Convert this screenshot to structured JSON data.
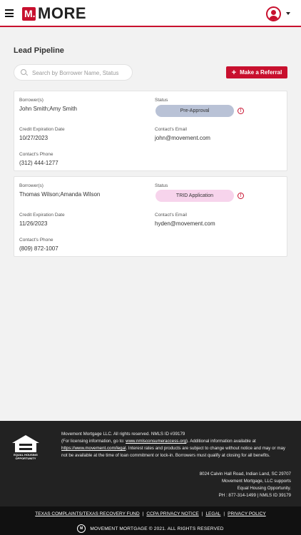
{
  "header": {
    "logo_badge": "M.",
    "logo_text": "MORE"
  },
  "page": {
    "title": "Lead Pipeline",
    "search_placeholder": "Search by Borrower Name, Status",
    "referral_label": "Make a Referral"
  },
  "labels": {
    "borrowers": "Borrower(s)",
    "status": "Status",
    "credit_expiration": "Credit Expiration Date",
    "contact_email": "Contact's Email",
    "contact_phone": "Contact's Phone"
  },
  "leads": [
    {
      "borrowers": "John Smith;Amy Smith",
      "status": "Pre-Approval",
      "status_color": "#b9c2d6",
      "credit_expiration": "10/27/2023",
      "email": "john@movement.com",
      "phone": "(312) 444-1277"
    },
    {
      "borrowers": "Thomas Wilson;Amanda Wilson",
      "status": "TRID Application",
      "status_color": "#f7d4ec",
      "credit_expiration": "11/26/2023",
      "email": "hyden@movement.com",
      "phone": "(809) 872-1007"
    }
  ],
  "footer": {
    "eho_text": "EQUAL HOUSING OPPORTUNITY",
    "legal_line1": "Movement Mortgage LLC. All rights reserved. NMLS ID #39179",
    "legal_line2_pre": "(For licensing information, go to: ",
    "legal_link1": "www.nmlsconsumeraccess.org",
    "legal_line2_post": "). Additional information available at ",
    "legal_link2": "https://www.movement.com/legal",
    "legal_line3": ". Interest rates and products are subject to change without notice and may or may not be available at the time of loan commitment or lock-in. Borrowers must qualify at closing for all benefits.",
    "address1": "8024 Calvin Hall Road, Indian Land, SC 29707",
    "address2": "Movement Mortgage, LLC supports",
    "address3": "Equal Housing Opportunity.",
    "address4": "PH : 877-314-1499 | NMLS ID 39179",
    "link_complaints": "TEXAS COMPLAINTS/TEXAS RECOVERY FUND",
    "link_ccpa": "CCPA PRIVACY NOTICE",
    "link_legal": "LEGAL",
    "link_privacy": "PRIVACY POLICY",
    "separator": "|",
    "copyright_logo": "M",
    "copyright": "MOVEMENT MORTGAGE © 2021. ALL RIGHTS RESERVED"
  },
  "colors": {
    "brand_red": "#c8102e",
    "footer_bg": "#222222"
  }
}
